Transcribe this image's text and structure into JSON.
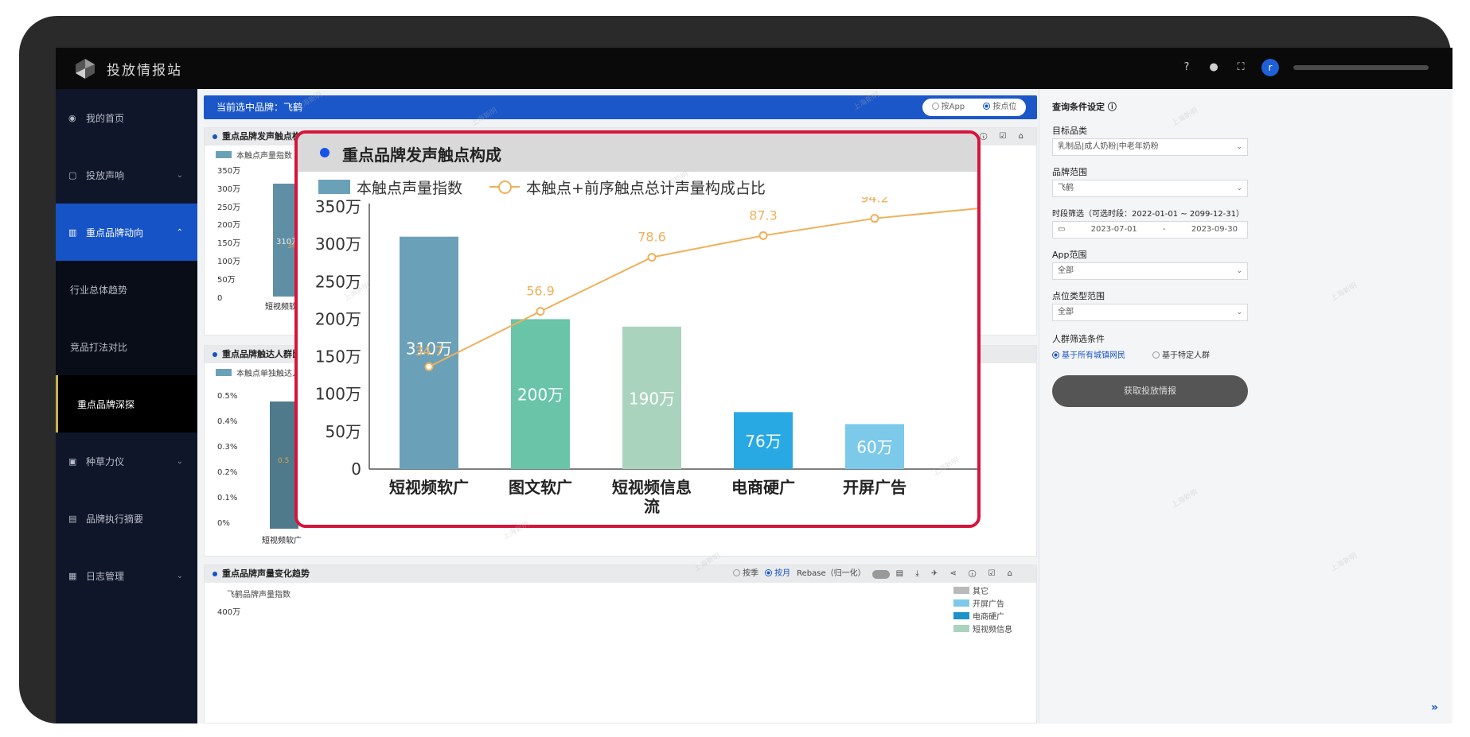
{
  "app": {
    "title": "投放情报站",
    "avatar_letter": "r"
  },
  "sidebar": {
    "items": [
      {
        "icon": "◉",
        "label": "我的首页",
        "chevron": ""
      },
      {
        "icon": "▢",
        "label": "投放声响",
        "chevron": "⌄"
      },
      {
        "icon": "▥",
        "label": "重点品牌动向",
        "chevron": "⌃"
      },
      {
        "icon": "",
        "label": "行业总体趋势",
        "chevron": ""
      },
      {
        "icon": "",
        "label": "竞品打法对比",
        "chevron": ""
      },
      {
        "icon": "",
        "label": "重点品牌深探",
        "chevron": ""
      },
      {
        "icon": "▣",
        "label": "种草力仪",
        "chevron": "⌄"
      },
      {
        "icon": "▤",
        "label": "品牌执行摘要",
        "chevron": ""
      },
      {
        "icon": "▦",
        "label": "日志管理",
        "chevron": "⌄"
      }
    ]
  },
  "brand_bar": {
    "label": "当前选中品牌：飞鹤",
    "opt_app": "按App",
    "opt_pos": "按点位"
  },
  "panels": {
    "touchpoint": {
      "title": "重点品牌发声触点构成",
      "tools": "▤ ⤓ ✈ ⋖ ⓘ ☑ ⌂",
      "legend": "本触点声量指数",
      "yticks": [
        "350万",
        "300万",
        "250万",
        "200万",
        "150万",
        "100万",
        "50万",
        "0"
      ],
      "bar_label": "310万",
      "point_label": "34.7",
      "xlabel": "短视频软广"
    },
    "reach": {
      "title": "重点品牌触达人群比例",
      "legend": "本触点单独触达人群比",
      "yticks": [
        "0.5%",
        "0.4%",
        "0.3%",
        "0.2%",
        "0.1%",
        "0%"
      ],
      "point_label": "0.5",
      "xlabel": "短视频软广"
    },
    "trend": {
      "title": "重点品牌声量变化趋势",
      "opt_season": "按季",
      "opt_month": "按月",
      "rebase": "Rebase（归一化）",
      "ylabel": "飞鹤品牌声量指数",
      "ytick": "400万",
      "legend": [
        "其它",
        "开屏广告",
        "电商硬广",
        "短视频信息"
      ]
    }
  },
  "filters": {
    "title": "查询条件设定 ⓘ",
    "category_label": "目标品类",
    "category_value": "乳制品|成人奶粉|中老年奶粉",
    "brand_label": "品牌范围",
    "brand_value": "飞鹤",
    "period_label": "时段筛选（可选时段：2022-01-01 ~ 2099-12-31）",
    "period_start": "2023-07-01",
    "period_sep": "-",
    "period_end": "2023-09-30",
    "app_label": "App范围",
    "app_value": "全部",
    "pos_label": "点位类型范围",
    "pos_value": "全部",
    "crowd_label": "人群筛选条件",
    "crowd_opt1": "基于所有城镇网民",
    "crowd_opt2": "基于特定人群",
    "submit": "获取投放情报"
  },
  "watermark_text": "上海新明",
  "colors": {
    "bar1": "#6aa1b8",
    "bar2": "#69c4a8",
    "bar3": "#a9d3bd",
    "bar4": "#29a9e3",
    "bar5": "#7cc9ea",
    "line": "#f0b05a",
    "accent": "#1553c6",
    "highlight": "#d6143c"
  },
  "chart_data": {
    "type": "bar",
    "title": "重点品牌发声触点构成",
    "categories": [
      "短视频软广",
      "图文软广",
      "短视频信息流",
      "电商硬广",
      "开屏广告"
    ],
    "series": [
      {
        "name": "本触点声量指数",
        "type": "bar",
        "values": [
          3100000,
          2000000,
          1900000,
          760000,
          600000
        ],
        "labels": [
          "310万",
          "200万",
          "190万",
          "76万",
          "60万"
        ]
      },
      {
        "name": "本触点+前序触点总计声量构成占比",
        "type": "line",
        "values": [
          34.7,
          56.9,
          78.6,
          87.3,
          94.2
        ]
      }
    ],
    "yticks": [
      "350万",
      "300万",
      "250万",
      "200万",
      "150万",
      "100万",
      "50万",
      "0"
    ],
    "ylim": [
      0,
      3500000
    ],
    "legend_position": "top-left",
    "grid": false
  }
}
